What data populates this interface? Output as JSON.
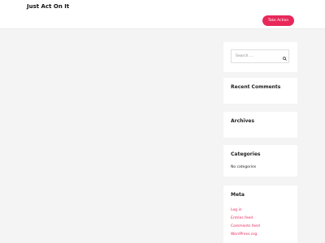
{
  "header": {
    "site_title": "Just Act On It",
    "cta_label": "Take Action"
  },
  "search": {
    "placeholder": "Search …"
  },
  "widgets": {
    "recent_comments_title": "Recent Comments",
    "archives_title": "Archives",
    "categories_title": "Categories",
    "categories_empty": "No categories",
    "meta_title": "Meta",
    "meta_links": [
      "Log in",
      "Entries feed",
      "Comments feed",
      "WordPress.org"
    ]
  },
  "colors": {
    "accent": "#e8285a",
    "background": "#f4f4f4",
    "widget_bg": "#ffffff"
  }
}
